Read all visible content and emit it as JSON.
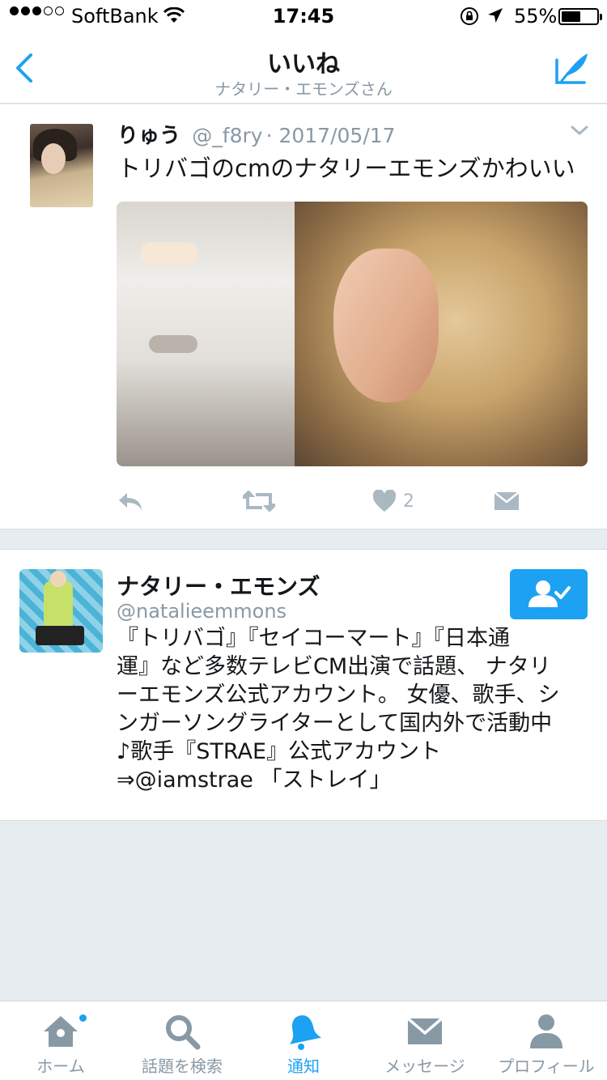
{
  "status_bar": {
    "carrier": "SoftBank",
    "time": "17:45",
    "battery_percent_label": "55%",
    "battery_level": 0.55
  },
  "nav": {
    "title": "いいね",
    "subtitle": "ナタリー・エモンズさん",
    "back_icon": "chevron-left-icon",
    "compose_icon": "compose-icon"
  },
  "tweet": {
    "name": "りゅう",
    "handle": "@_f8ry",
    "date": "· 2017/05/17",
    "text": "トリバゴのcmのナタリーエモンズかわいい",
    "like_count": "2",
    "colors": {
      "action": "#aab8c2",
      "meta": "#8899a6"
    }
  },
  "user_card": {
    "name": "ナタリー・エモンズ",
    "handle": "@natalieemmons",
    "bio_lines": [
      "『トリバゴ』『セイコーマート』『日本通",
      "運』など多数テレビCM出演で話題、 ナタリ",
      "ーエモンズ公式アカウント。 女優、歌手、シ",
      "ンガーソングライターとして国内外で活動中",
      "♪歌手『STRAE』公式アカウント",
      "⇒@iamstrae 「ストレイ」"
    ],
    "follow_icon": "following-check-icon",
    "accent": "#1da1f2"
  },
  "tabs": [
    {
      "label": "ホーム",
      "icon": "home-icon",
      "active": false,
      "badge": true
    },
    {
      "label": "話題を検索",
      "icon": "search-icon",
      "active": false,
      "badge": false
    },
    {
      "label": "通知",
      "icon": "bell-icon",
      "active": true,
      "badge": false
    },
    {
      "label": "メッセージ",
      "icon": "envelope-icon",
      "active": false,
      "badge": false
    },
    {
      "label": "プロフィール",
      "icon": "person-icon",
      "active": false,
      "badge": false
    }
  ]
}
